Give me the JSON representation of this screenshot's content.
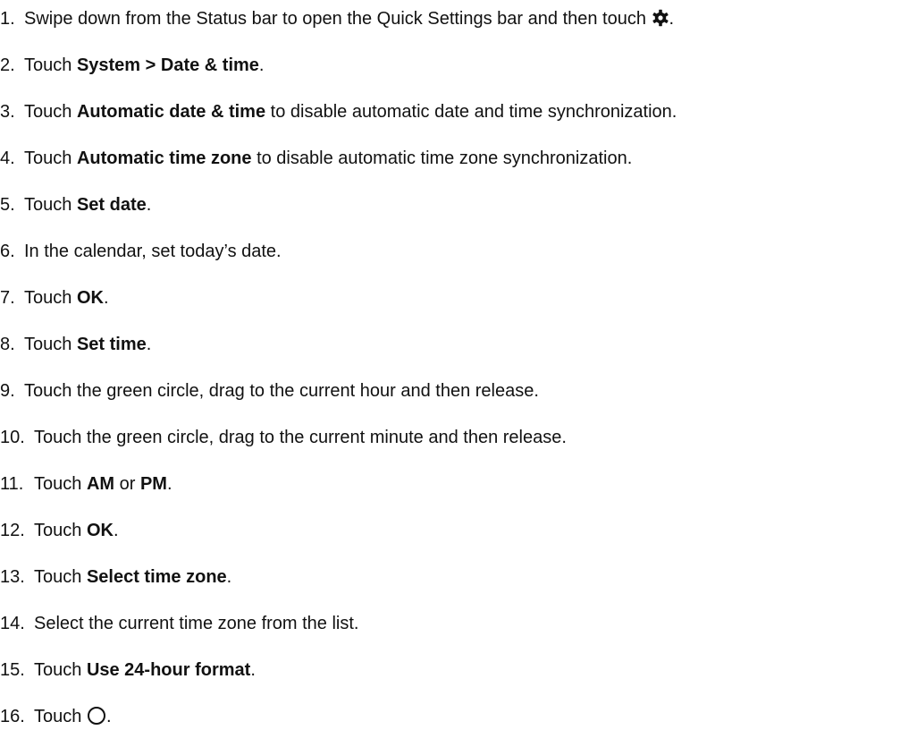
{
  "steps": [
    {
      "number": "1.",
      "parts": [
        "Swipe down from the Status bar to open the Quick Settings bar and then touch ",
        "."
      ],
      "icon": "gear-icon"
    },
    {
      "number": "2.",
      "pre": "Touch ",
      "bold": "System > Date & time",
      "post": "."
    },
    {
      "number": "3.",
      "pre": "Touch ",
      "bold": "Automatic date & time",
      "post": " to disable automatic date and time synchronization."
    },
    {
      "number": "4.",
      "pre": "Touch ",
      "bold": "Automatic time zone",
      "post": " to disable automatic time zone synchronization."
    },
    {
      "number": "5.",
      "pre": "Touch ",
      "bold": "Set date",
      "post": "."
    },
    {
      "number": "6.",
      "text": "In the calendar, set today’s date."
    },
    {
      "number": "7.",
      "pre": "Touch ",
      "bold": "OK",
      "post": "."
    },
    {
      "number": "8.",
      "pre": "Touch ",
      "bold": "Set time",
      "post": "."
    },
    {
      "number": "9.",
      "text": "Touch the green circle, drag to the current hour and then release."
    },
    {
      "number": "10.",
      "text": "Touch the green circle, drag to the current minute and then release."
    },
    {
      "number": "11.",
      "pre": "Touch ",
      "bold": "AM",
      "mid": " or ",
      "bold2": "PM",
      "post": "."
    },
    {
      "number": "12.",
      "pre": "Touch ",
      "bold": "OK",
      "post": "."
    },
    {
      "number": "13.",
      "pre": "Touch ",
      "bold": "Select time zone",
      "post": "."
    },
    {
      "number": "14.",
      "text": "Select the current time zone from the list."
    },
    {
      "number": "15.",
      "pre": "Touch ",
      "bold": "Use 24-hour format",
      "post": "."
    },
    {
      "number": "16.",
      "parts": [
        "Touch ",
        "."
      ],
      "icon": "home-circle-icon"
    }
  ]
}
